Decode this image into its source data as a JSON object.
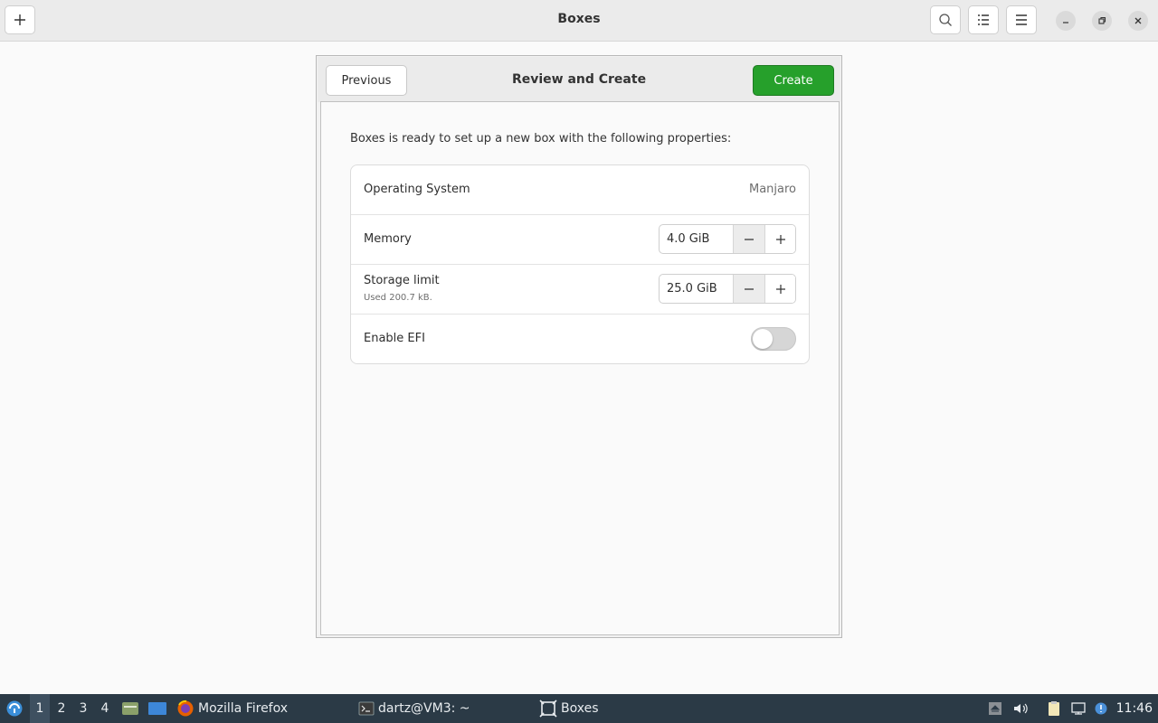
{
  "window": {
    "title": "Boxes",
    "new_button_icon": "plus-icon",
    "search_icon": "search-icon",
    "list_view_icon": "list-view-icon",
    "menu_icon": "hamburger-menu-icon"
  },
  "dialog": {
    "title": "Review and Create",
    "previous_label": "Previous",
    "create_label": "Create",
    "intro": "Boxes is ready to set up a new box with the following properties:",
    "accent_color": "#26a02b"
  },
  "properties": {
    "os": {
      "label": "Operating System",
      "value": "Manjaro"
    },
    "memory": {
      "label": "Memory",
      "value": "4.0 GiB"
    },
    "storage": {
      "label": "Storage limit",
      "sublabel": "Used 200.7 kB.",
      "value": "25.0 GiB"
    },
    "efi": {
      "label": "Enable EFI",
      "enabled": false
    }
  },
  "taskbar": {
    "workspaces": [
      "1",
      "2",
      "3",
      "4"
    ],
    "active_workspace": "1",
    "apps": [
      {
        "label": "Mozilla Firefox",
        "icon": "firefox-icon"
      },
      {
        "label": "dartz@VM3: ~",
        "icon": "terminal-icon"
      },
      {
        "label": "Boxes",
        "icon": "boxes-icon"
      }
    ],
    "clock": "11:46"
  }
}
